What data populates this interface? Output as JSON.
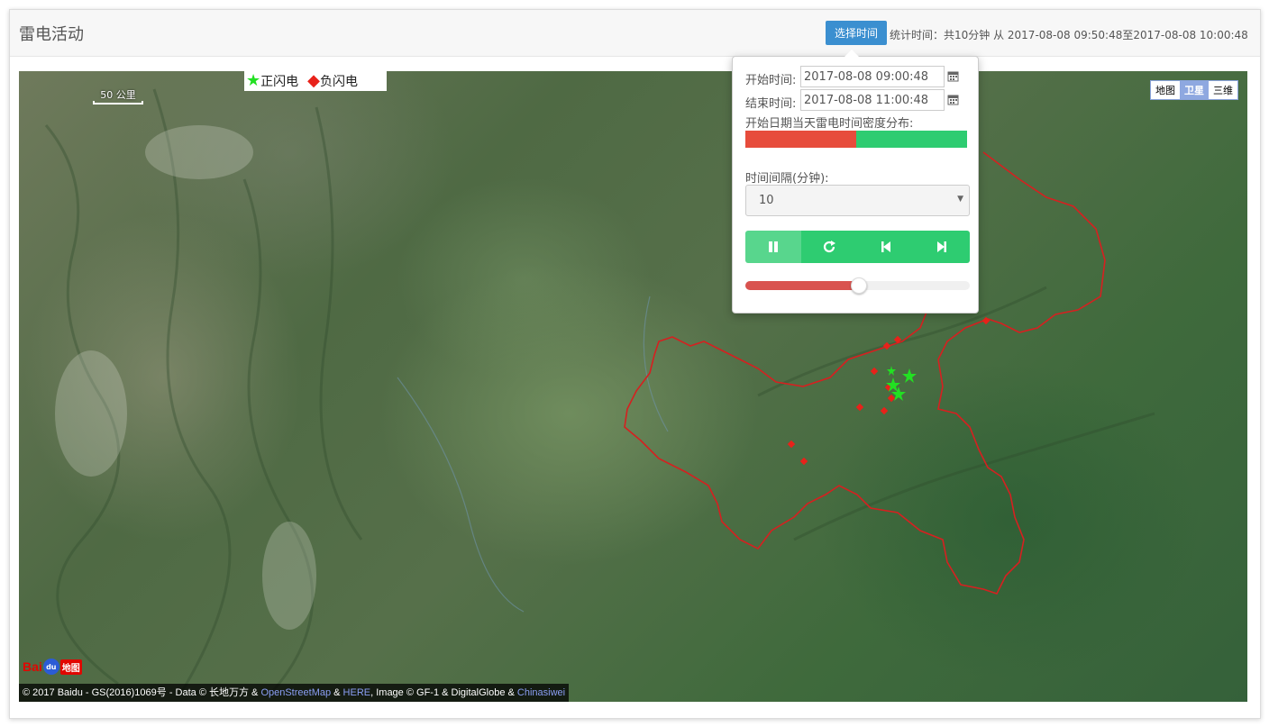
{
  "header": {
    "title": "雷电活动",
    "select_time_button": "选择时间",
    "stat_text": "统计时间：共10分钟 从 2017-08-08 09:50:48至2017-08-08 10:00:48"
  },
  "panel": {
    "start_label": "开始时间:",
    "start_value": "2017-08-08 09:00:48",
    "end_label": "结束时间:",
    "end_value": "2017-08-08 11:00:48",
    "density_label": "开始日期当天雷电时间密度分布:",
    "density_red_fraction": 0.5,
    "interval_label": "时间间隔(分钟):",
    "interval_value": "10",
    "controls": {
      "pause_icon": "pause-icon",
      "refresh_icon": "refresh-icon",
      "prev_icon": "skip-back-icon",
      "next_icon": "skip-forward-icon"
    },
    "progress_fraction": 0.5
  },
  "map": {
    "legend_positive": "正闪电",
    "legend_negative": "负闪电",
    "scale_label": "50 公里",
    "maptype": [
      "地图",
      "卫星",
      "三维"
    ],
    "maptype_active": "卫星",
    "logo_left": "Bai",
    "logo_right": "地图",
    "copyright_text": "© 2017 Baidu - GS(2016)1069号 - Data © 长地万方 & ",
    "copyright_osm": "OpenStreetMap",
    "copyright_amp": " & ",
    "copyright_here": "HERE",
    "copyright_image": ", Image © GF-1 & DigitalGlobe & ",
    "copyright_chinasiwei": "Chinasiwei"
  },
  "colors": {
    "positive": "#22e022",
    "negative": "#e8221a",
    "boundary": "#d62020",
    "button_blue": "#3b8fd0",
    "green": "#2ecc71",
    "red": "#e74c3c"
  }
}
